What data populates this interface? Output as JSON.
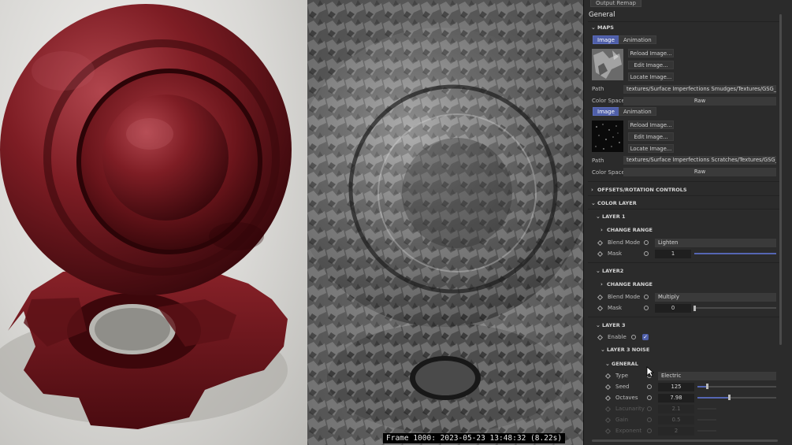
{
  "viewport_left": {
    "description_hidden": ""
  },
  "viewport_mid": {
    "frame_info": "Frame 1000: 2023-05-23 13:48:32 (8.22s)"
  },
  "panel": {
    "top_button": "Output Remap",
    "title": "General",
    "maps": {
      "label": "MAPS",
      "map1": {
        "tab_image": "Image",
        "tab_animation": "Animation",
        "reload": "Reload Image...",
        "edit": "Edit Image...",
        "locate": "Locate Image...",
        "path_label": "Path",
        "path_value": "textures/Surface Imperfections Smudges/Textures/GSG_SI_S",
        "colorspace_label": "Color Space",
        "colorspace_value": "Raw"
      },
      "map2": {
        "tab_image": "Image",
        "tab_animation": "Animation",
        "reload": "Reload Image...",
        "edit": "Edit Image...",
        "locate": "Locate Image...",
        "path_label": "Path",
        "path_value": "textures/Surface Imperfections Scratches/Textures/GSG_SI_S",
        "colorspace_label": "Color Space",
        "colorspace_value": "Raw"
      }
    },
    "offsets_label": "OFFSETS/ROTATION CONTROLS",
    "color_layer_label": "COLOR LAYER",
    "layer1": {
      "label": "LAYER 1",
      "change_range": "CHANGE RANGE",
      "blend_label": "Blend Mode",
      "blend_value": "Lighten",
      "mask_label": "Mask",
      "mask_value": "1",
      "mask_fraction": 1.0
    },
    "layer2": {
      "label": "LAYER2",
      "change_range": "CHANGE RANGE",
      "blend_label": "Blend Mode",
      "blend_value": "Multiply",
      "mask_label": "Mask",
      "mask_value": "0",
      "mask_fraction": 0.0
    },
    "layer3": {
      "label": "LAYER 3",
      "enable_label": "Enable",
      "enabled": true,
      "noise_label": "LAYER 3 NOISE",
      "general_label": "GENERAL",
      "type_label": "Type",
      "type_value": "Electric",
      "seed_label": "Seed",
      "seed_value": "125",
      "seed_fraction": 0.12,
      "octaves_label": "Octaves",
      "octaves_value": "7.98",
      "octaves_fraction": 0.4,
      "lacunarity_label": "Lacunarity",
      "lacunarity_value": "2.1",
      "gain_label": "Gain",
      "gain_value": "0.5",
      "exponent_label": "Exponent",
      "exponent_value": "2"
    },
    "accent_color": "#4f5fa9"
  }
}
